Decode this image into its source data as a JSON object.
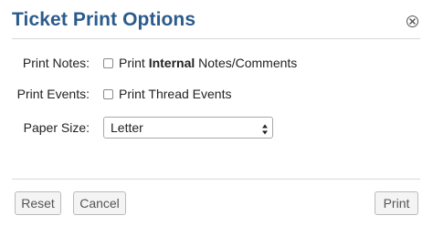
{
  "dialog": {
    "title": "Ticket Print Options",
    "close_icon": "close-circle-icon"
  },
  "form": {
    "print_notes": {
      "label": "Print Notes:",
      "checked": false,
      "text_prefix": "Print ",
      "text_bold": "Internal",
      "text_suffix": " Notes/Comments"
    },
    "print_events": {
      "label": "Print Events:",
      "checked": false,
      "text": "Print Thread Events"
    },
    "paper_size": {
      "label": "Paper Size:",
      "selected": "Letter",
      "icon": "select-arrows-icon"
    }
  },
  "footer": {
    "reset_label": "Reset",
    "cancel_label": "Cancel",
    "print_label": "Print"
  }
}
